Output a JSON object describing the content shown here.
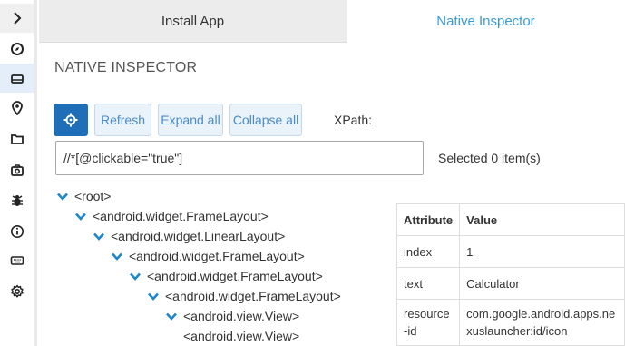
{
  "tabs": {
    "install": "Install App",
    "native": "Native Inspector"
  },
  "page_title": "NATIVE INSPECTOR",
  "toolbar": {
    "refresh": "Refresh",
    "expand_all": "Expand all",
    "collapse_all": "Collapse all",
    "xpath_label": "XPath:"
  },
  "xpath": {
    "value": "//*[@clickable=\"true\"]"
  },
  "selected_text": "Selected 0 item(s)",
  "sidebar": {
    "icons": [
      "chevron-right-icon",
      "compass-icon",
      "device-icon",
      "location-pin-icon",
      "folder-icon",
      "camera-icon",
      "bug-icon",
      "info-icon",
      "keyboard-icon",
      "settings-icon"
    ]
  },
  "tree": [
    {
      "label": "<root>",
      "expanded": true
    },
    {
      "label": "<android.widget.FrameLayout>",
      "expanded": true
    },
    {
      "label": "<android.widget.LinearLayout>",
      "expanded": true
    },
    {
      "label": "<android.widget.FrameLayout>",
      "expanded": true
    },
    {
      "label": "<android.widget.FrameLayout>",
      "expanded": true
    },
    {
      "label": "<android.widget.FrameLayout>",
      "expanded": true
    },
    {
      "label": "<android.view.View>",
      "expanded": true
    },
    {
      "label": "<android.view.View>",
      "expanded": false
    }
  ],
  "attributes": {
    "header": {
      "attribute": "Attribute",
      "value": "Value"
    },
    "rows": [
      {
        "attribute": "index",
        "value": "1"
      },
      {
        "attribute": "text",
        "value": "Calculator"
      },
      {
        "attribute": "resource-id",
        "value": "com.google.android.apps.nexuslauncher:id/icon"
      }
    ]
  },
  "colors": {
    "accent": "#3a9bd8",
    "primary_button": "#1e6fb7",
    "active_rail": "#e3eefa"
  }
}
